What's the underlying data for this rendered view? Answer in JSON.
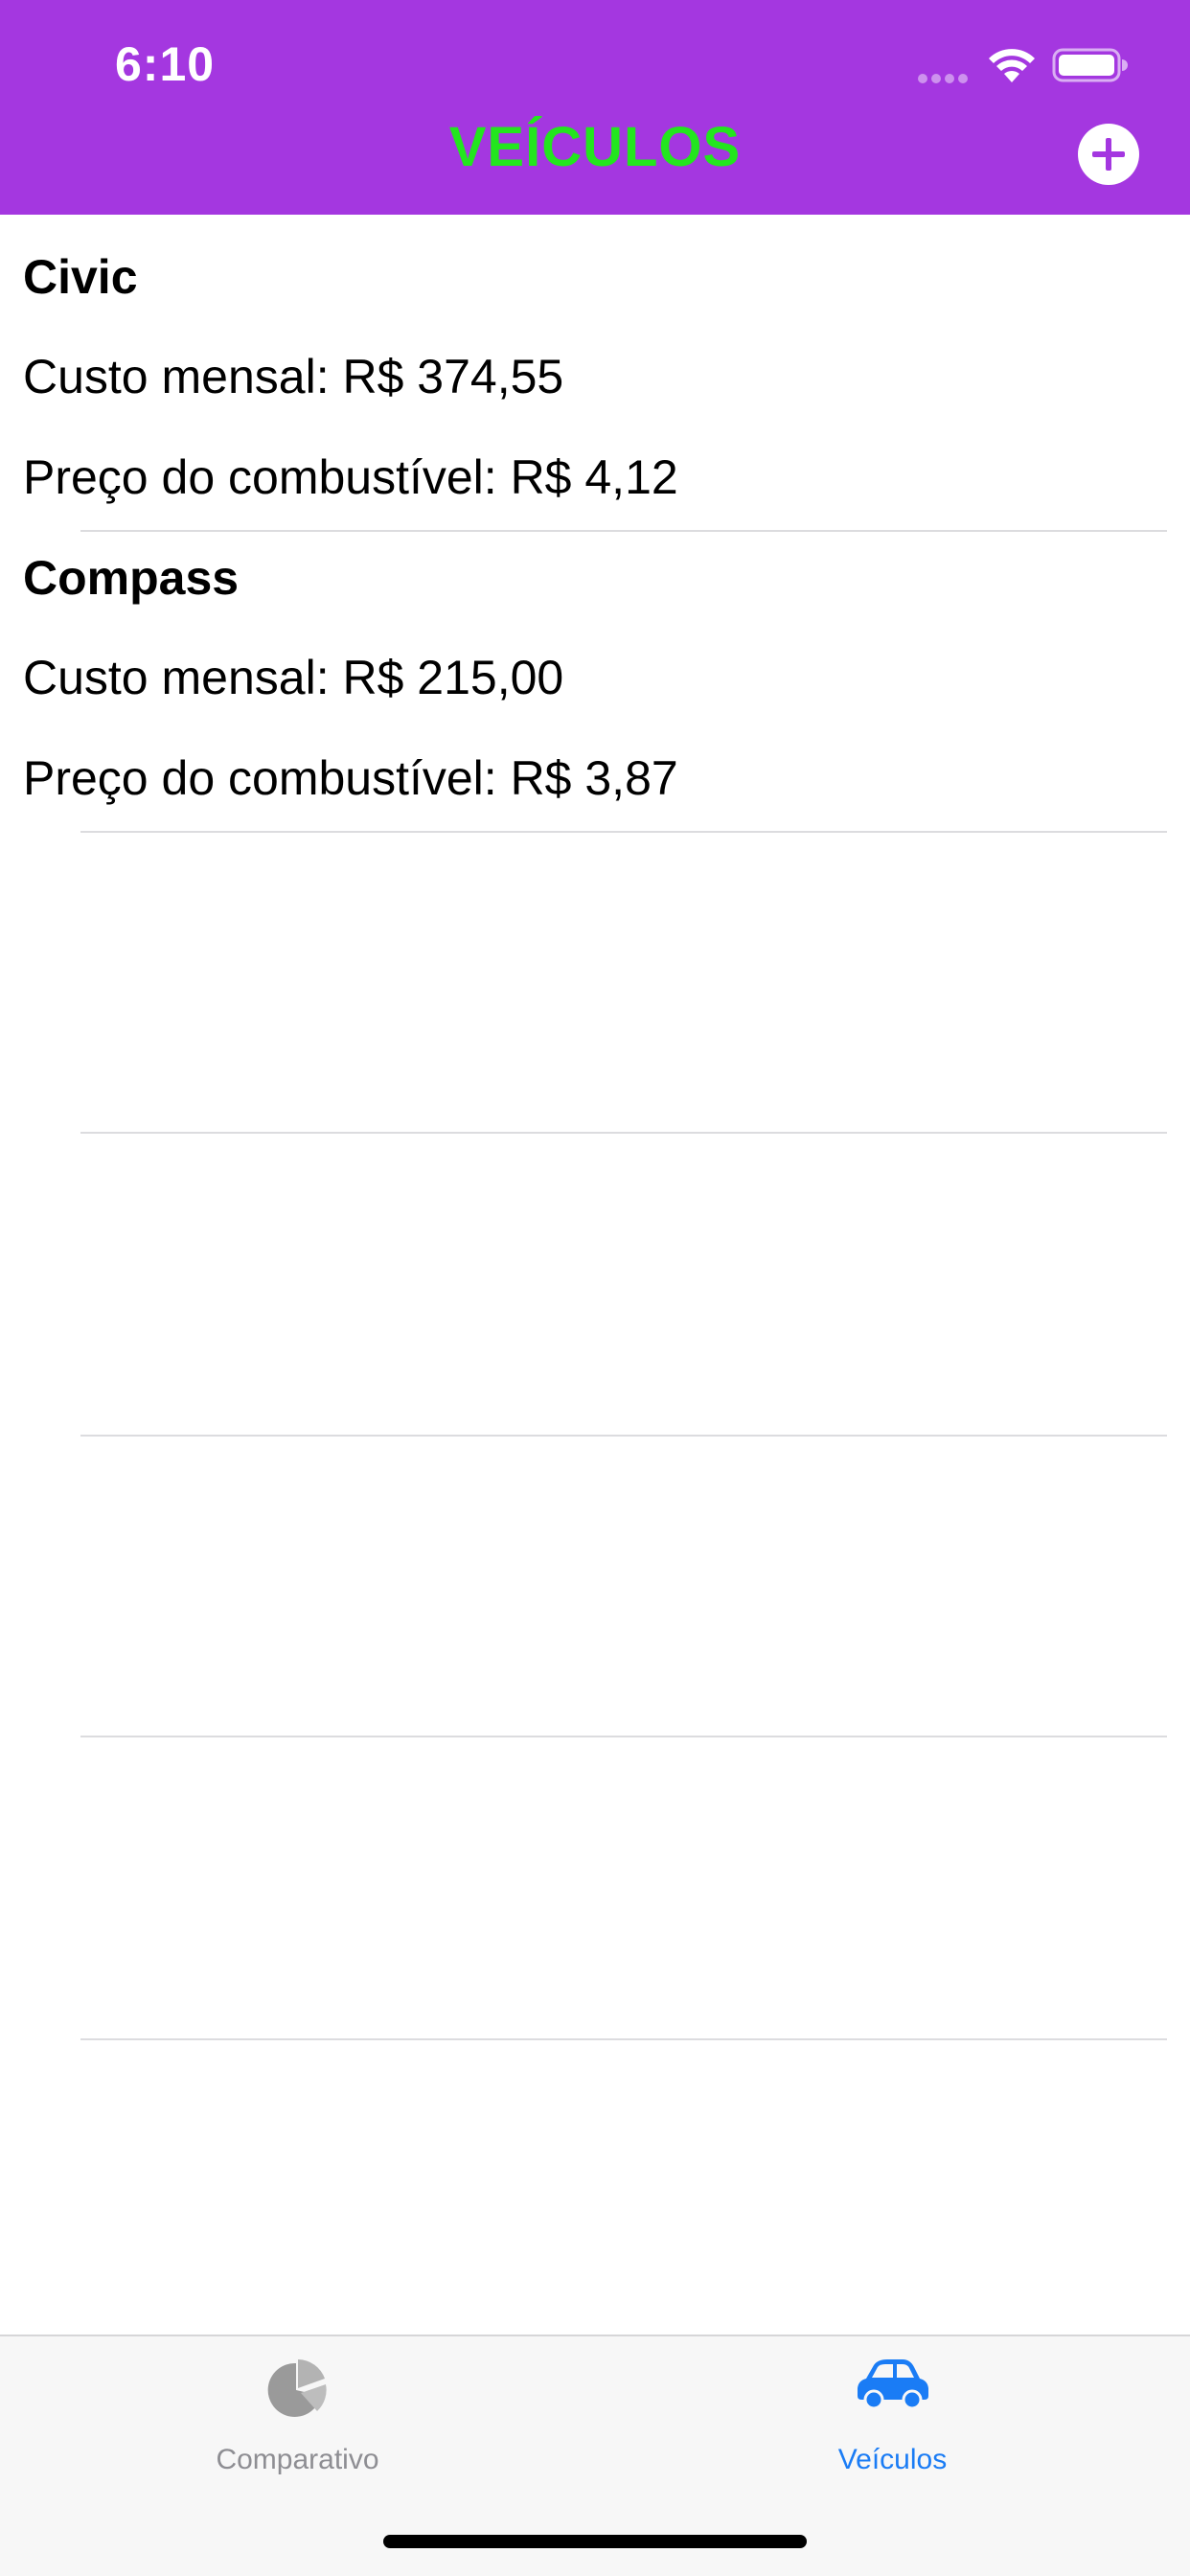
{
  "status_bar": {
    "time": "6:10"
  },
  "nav": {
    "title": "VEÍCULOS",
    "title_color": "#23e61e",
    "bar_color": "#a437e0",
    "add_icon": "plus-circle-icon"
  },
  "vehicles": [
    {
      "name": "Civic",
      "monthly_cost": "Custo mensal: R$ 374,55",
      "fuel_price": "Preço do combustível: R$ 4,12"
    },
    {
      "name": "Compass",
      "monthly_cost": "Custo mensal: R$ 215,00",
      "fuel_price": "Preço do combustível: R$ 3,87"
    }
  ],
  "tab_bar": {
    "tabs": [
      {
        "label": "Comparativo",
        "icon": "pie-chart-icon",
        "selected": false,
        "color": "#8e8e93"
      },
      {
        "label": "Veículos",
        "icon": "car-icon",
        "selected": true,
        "color": "#1a7cf5"
      }
    ]
  }
}
